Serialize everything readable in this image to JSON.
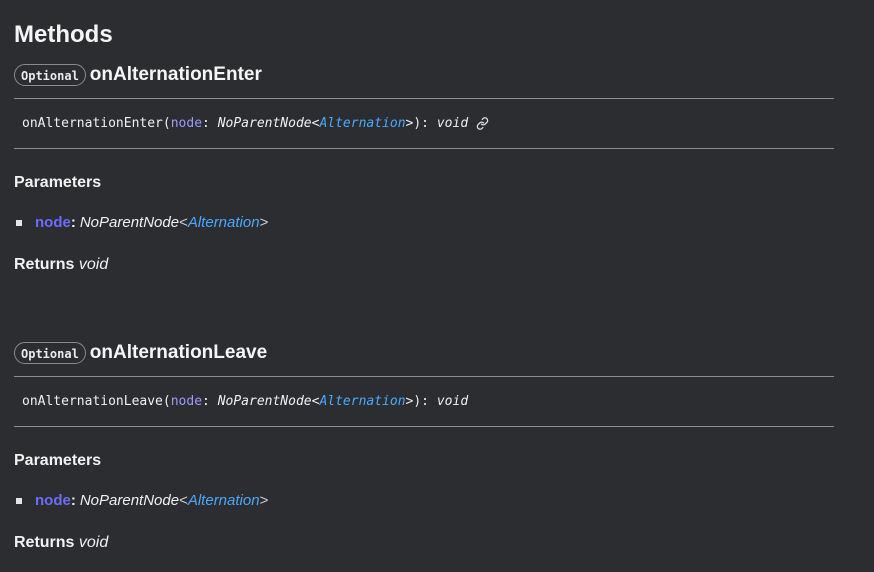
{
  "section_title": "Methods",
  "methods": [
    {
      "badge": "Optional",
      "name": "onAlternationEnter",
      "signature": {
        "fn": "onAlternationEnter",
        "open_paren": "(",
        "param": "node",
        "colon": ": ",
        "type": "NoParentNode",
        "lt": "<",
        "generic": "Alternation",
        "gt": ">",
        "close": "): ",
        "return_type": "void",
        "has_link_icon": true
      },
      "parameters_heading": "Parameters",
      "parameters": [
        {
          "name": "node",
          "colon": ":",
          "type": "NoParentNode",
          "lt": "<",
          "generic": "Alternation",
          "gt": ">"
        }
      ],
      "returns_label": "Returns",
      "returns_type": "void"
    },
    {
      "badge": "Optional",
      "name": "onAlternationLeave",
      "signature": {
        "fn": "onAlternationLeave",
        "open_paren": "(",
        "param": "node",
        "colon": ": ",
        "type": "NoParentNode",
        "lt": "<",
        "generic": "Alternation",
        "gt": ">",
        "close": "): ",
        "return_type": "void",
        "has_link_icon": false
      },
      "parameters_heading": "Parameters",
      "parameters": [
        {
          "name": "node",
          "colon": ":",
          "type": "NoParentNode",
          "lt": "<",
          "generic": "Alternation",
          "gt": ">"
        }
      ],
      "returns_label": "Returns",
      "returns_type": "void"
    }
  ],
  "colors": {
    "background": "#2b2d31",
    "param_name": "#6c6cff",
    "type_link": "#4aa8ff"
  },
  "icons": {
    "signature_link": "link-icon"
  }
}
